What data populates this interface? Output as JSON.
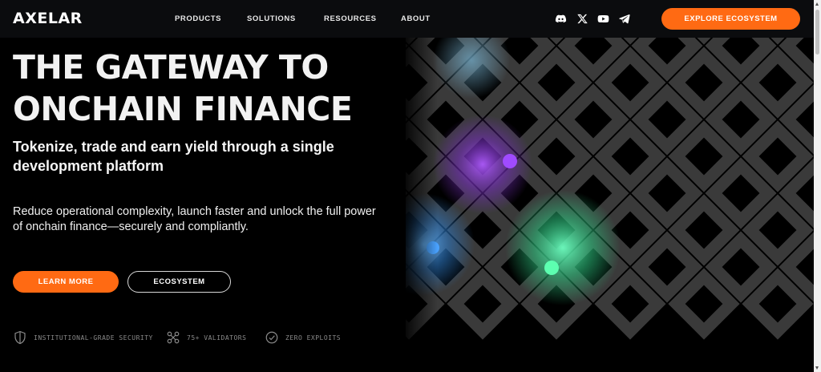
{
  "brand": {
    "logo_text": "AXELAR"
  },
  "nav": {
    "links": [
      "PRODUCTS",
      "SOLUTIONS",
      "RESOURCES",
      "ABOUT"
    ],
    "social_icons": [
      "discord-icon",
      "x-icon",
      "youtube-icon",
      "telegram-icon"
    ],
    "cta_label": "EXPLORE ECOSYSTEM"
  },
  "hero": {
    "headline_line1": "THE GATEWAY TO",
    "headline_line2": "ONCHAIN FINANCE",
    "subhead": "Tokenize, trade and earn yield through a single development platform",
    "description": "Reduce operational complexity, launch faster and unlock the full power of onchain finance—securely and compliantly.",
    "primary_button": "LEARN MORE",
    "secondary_button": "ECOSYSTEM"
  },
  "features": [
    {
      "icon": "shield-icon",
      "label": "INSTITUTIONAL-GRADE SECURITY"
    },
    {
      "icon": "validators-icon",
      "label": "75+ VALIDATORS"
    },
    {
      "icon": "check-badge-icon",
      "label": "ZERO EXPLOITS"
    }
  ],
  "colors": {
    "accent": "#ff6a13",
    "background": "#000000",
    "nav_background": "#0b0c0e",
    "grid": "#3a3a3a",
    "glow_purple": "#8b3fd6",
    "glow_green": "#3ee89a",
    "glow_blue": "#3a8fd8"
  }
}
